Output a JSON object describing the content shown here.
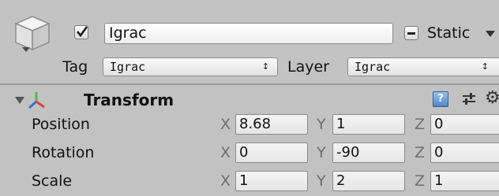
{
  "gameobject": {
    "active": true,
    "name": "Igrac",
    "static_label": "Static",
    "static_state": "mixed",
    "tag_label": "Tag",
    "tag_value": "Igrac",
    "layer_label": "Layer",
    "layer_value": "Igrac",
    "popup_arrows": "↕",
    "icons": [
      "gameobject-cube-icon",
      "checkmark-icon",
      "dropdown-caret-icon"
    ]
  },
  "transform": {
    "title": "Transform",
    "icons": [
      "transform-axes-icon",
      "help-icon",
      "preset-icon",
      "gear-icon"
    ],
    "help_glyph": "?",
    "gear_glyph": "⚙",
    "axis_labels": [
      "X",
      "Y",
      "Z"
    ],
    "rows": [
      {
        "label": "Position",
        "x": "8.68",
        "y": "1",
        "z": "0"
      },
      {
        "label": "Rotation",
        "x": "0",
        "y": "-90",
        "z": "0"
      },
      {
        "label": "Scale",
        "x": "1",
        "y": "2",
        "z": "1"
      }
    ]
  },
  "colors": {
    "background": "#c2c2c2",
    "axis_x": "#e0403a",
    "axis_y": "#4fb84a",
    "axis_z": "#3a6fd8",
    "help_blue": "#4f86c8"
  }
}
